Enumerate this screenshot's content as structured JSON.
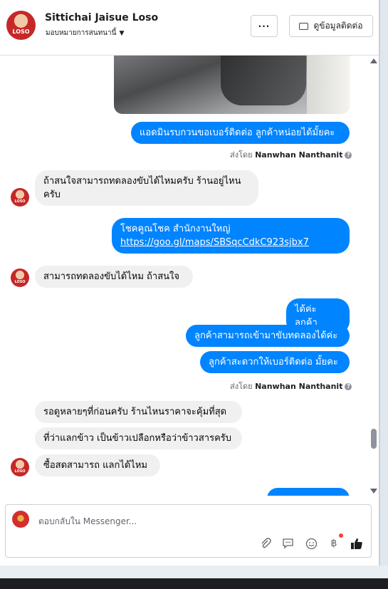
{
  "header": {
    "name": "Sittichai Jaisue Loso",
    "assign_label": "มอบหมายการสนทนานี้",
    "more_label": "···",
    "contact_label": "ดูข้อมูลติดต่อ",
    "avatar_logo": "LOSO"
  },
  "messages": [
    {
      "from": "page",
      "text": "แอดมินรบกวนขอเบอร์ติดต่อ ลูกค้าหน่อยได้มั้ยคะ"
    },
    {
      "sent_by_prefix": "ส่งโดย",
      "sent_by_name": "Nanwhan Nanthanit"
    },
    {
      "from": "customer",
      "text": "ถ้าสนใจสามารถทดลองขับได้ไหมครับ ร้านอยู่ไหน ครับ"
    },
    {
      "from": "page",
      "text": "โชคคูณโชค สำนักงานใหญ่",
      "link": "https://goo.gl/maps/SBSqcCdkC923sjbx7"
    },
    {
      "from": "customer",
      "text": "สามารถทดลองขับได้ไหม ถ้าสนใจ"
    },
    {
      "from": "page",
      "text": "ได้ค่ะ ลูกค้า"
    },
    {
      "from": "page",
      "text": "ลูกค้าสามารถเข้ามาขับทดลองได้ค่ะ"
    },
    {
      "from": "page",
      "text": "ลูกค้าสะดวกให้เบอร์ติดต่อ มั้ยคะ"
    },
    {
      "sent_by_prefix": "ส่งโดย",
      "sent_by_name": "Nanwhan Nanthanit"
    },
    {
      "from": "customer",
      "text": "รอดูหลายๆที่ก่อนครับ  ร้านไหนราคาจะคุ้มที่สุด"
    },
    {
      "from": "customer",
      "text": "ที่ว่าแลกข้าว เป็นข้าวเปลือกหรือว่าข้าวสารครับ"
    },
    {
      "from": "customer",
      "text": "ซื้อสดสามารถ แลกได้ไหม"
    }
  ],
  "composer": {
    "placeholder": "ตอบกลับใน Messenger...",
    "tools": [
      "paperclip-icon",
      "saved-reply-icon",
      "emoji-icon",
      "baht-payment-icon",
      "thumbs-up-icon"
    ]
  },
  "colors": {
    "outgoing": "#0084ff",
    "incoming": "#f1f0f0",
    "accent_dot": "#fa3e3e"
  }
}
